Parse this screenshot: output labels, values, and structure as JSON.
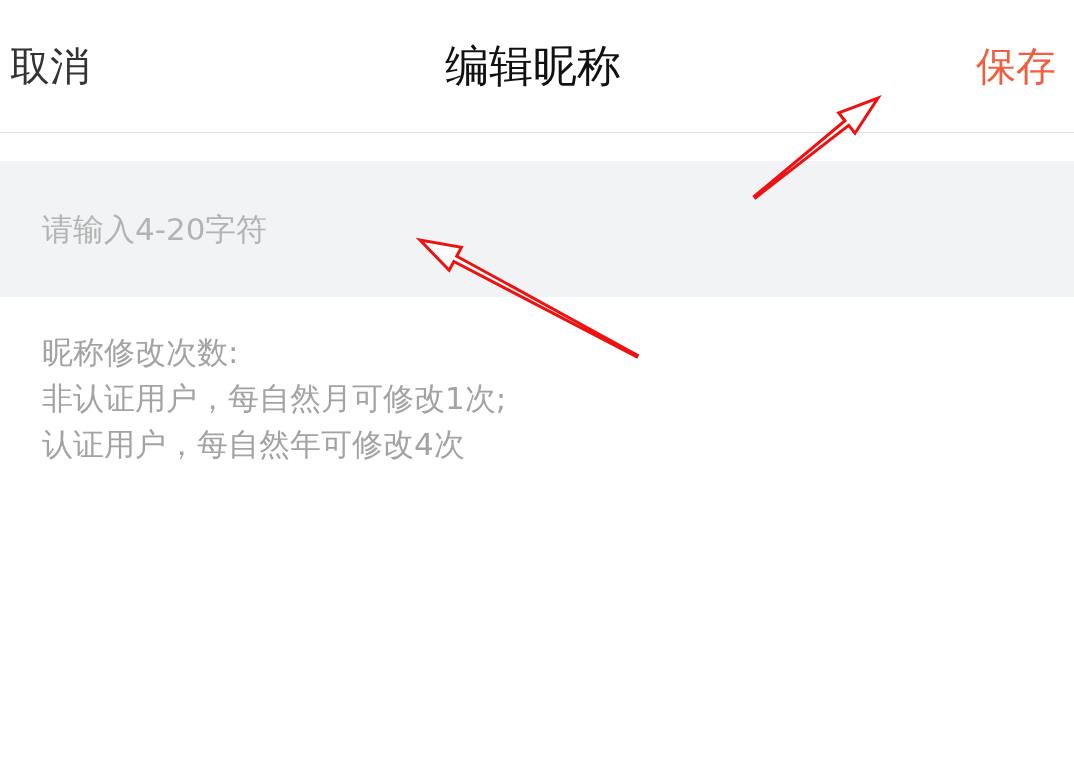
{
  "header": {
    "cancel": "取消",
    "title": "编辑昵称",
    "save": "保存"
  },
  "nickname_field": {
    "placeholder": "请输入4-20字符"
  },
  "rules": [
    "昵称修改次数:",
    "非认证用户，每自然月可修改1次;",
    "认证用户，每自然年可修改4次"
  ]
}
